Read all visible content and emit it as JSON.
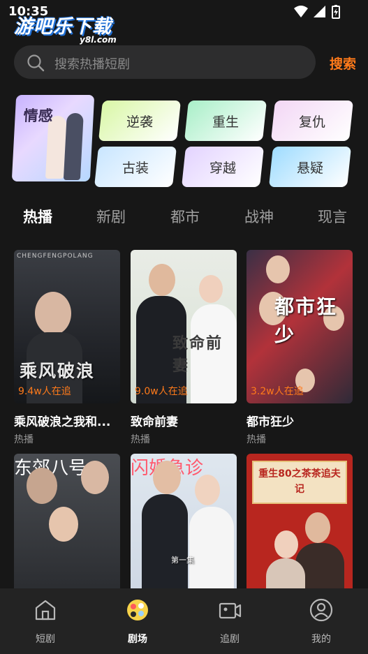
{
  "status_bar": {
    "time": "10:35"
  },
  "watermark": {
    "brand": "游吧乐下载",
    "domain": "y8l.com"
  },
  "search": {
    "placeholder": "搜索热播短剧",
    "button_label": "搜索"
  },
  "categories": {
    "featured": "情感",
    "chips": [
      {
        "label": "逆袭",
        "color": "#d9f7a6"
      },
      {
        "label": "重生",
        "color": "#a9efc8"
      },
      {
        "label": "复仇",
        "color": "#f3d7f5"
      },
      {
        "label": "古装",
        "color": "#c9e6ff"
      },
      {
        "label": "穿越",
        "color": "#e3d3ff"
      },
      {
        "label": "悬疑",
        "color": "#9fdcff"
      }
    ]
  },
  "tabs": [
    "热播",
    "新剧",
    "都市",
    "战神",
    "现言"
  ],
  "dramas": [
    {
      "title": "乘风破浪之我和...",
      "tag": "热播",
      "watching": "9.4w人在追",
      "poster_text": "乘风破浪",
      "poster_header": "CHENGFENGPOLANG"
    },
    {
      "title": "致命前妻",
      "tag": "热播",
      "watching": "9.0w人在追",
      "poster_text": "致命前妻"
    },
    {
      "title": "都市狂少",
      "tag": "热播",
      "watching": "3.2w人在追",
      "poster_text": "都市狂少"
    },
    {
      "poster_text": "东郊八号"
    },
    {
      "poster_text": "闪婚急诊",
      "poster_sub": "第一集"
    },
    {
      "poster_text": "重生80之茶茶追夫记"
    }
  ],
  "nav": [
    {
      "label": "短剧",
      "icon": "home-icon"
    },
    {
      "label": "剧场",
      "icon": "theater-icon"
    },
    {
      "label": "追剧",
      "icon": "video-icon"
    },
    {
      "label": "我的",
      "icon": "profile-icon"
    }
  ]
}
